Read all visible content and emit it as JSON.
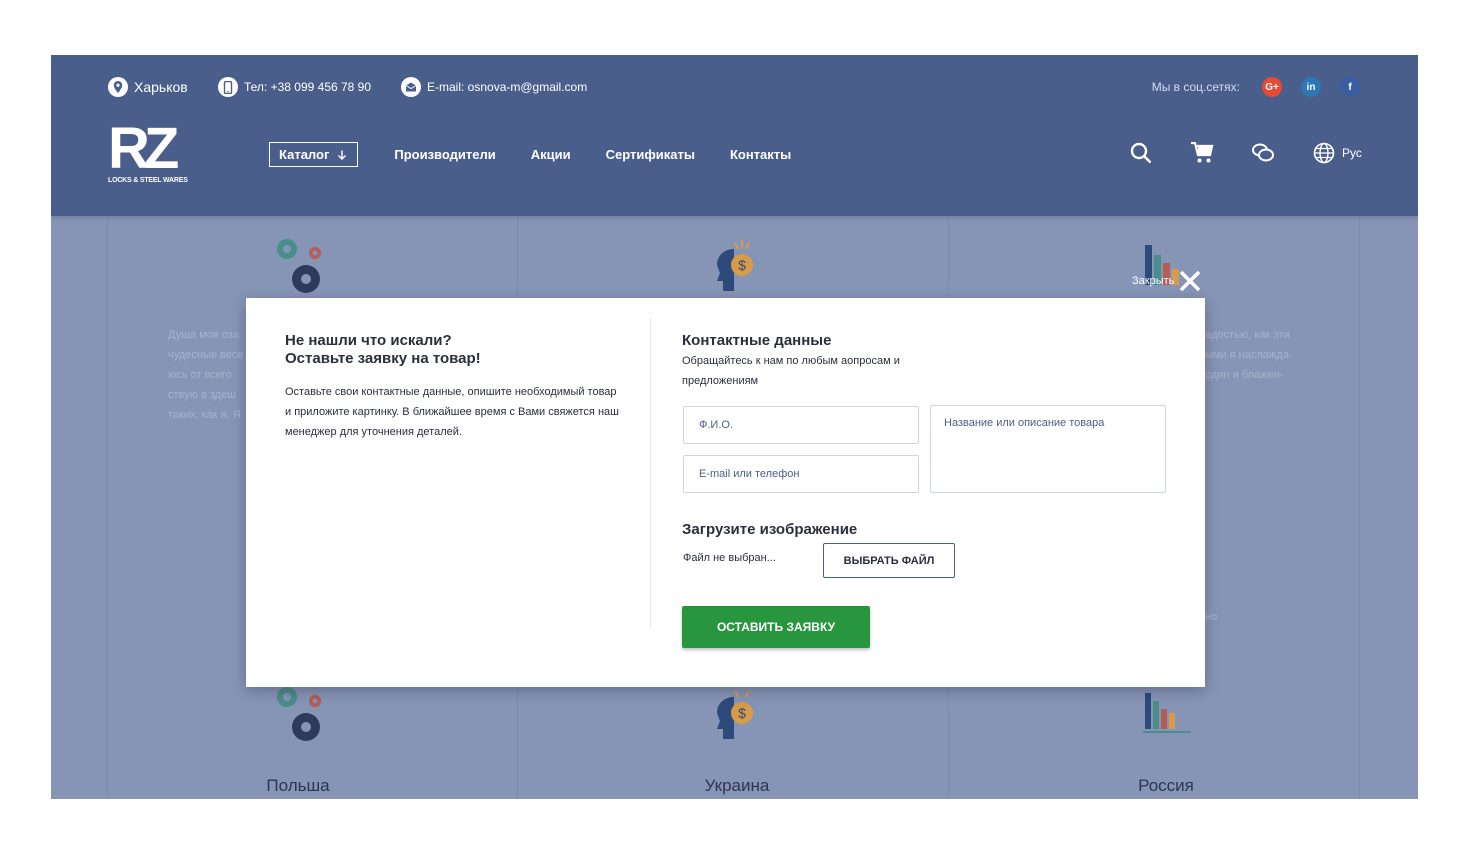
{
  "header": {
    "city": "Харьков",
    "phone": "Тел: +38 099 456 78 90",
    "email": "E-mail: osnova-m@gmail.com",
    "social_label": "Мы в соц.сетях:",
    "social": [
      {
        "name": "google-plus",
        "label": "G+"
      },
      {
        "name": "linkedin",
        "label": "in"
      },
      {
        "name": "facebook",
        "label": "f"
      }
    ],
    "logo_mark": "RZ",
    "logo_sub": "LOCKS & STEEL WARES",
    "nav": {
      "catalog": "Каталог",
      "items": [
        "Производители",
        "Акции",
        "Сертификаты",
        "Контакты"
      ]
    },
    "language": "Рус"
  },
  "background": {
    "countries": [
      "Польша",
      "Украина",
      "Россия"
    ],
    "left_text": [
      "Душа моя оза",
      "чудесные весе",
      "юсь от всего",
      "ствую в здеш",
      "таких, как я. Я"
    ],
    "right_text": [
      "адостью, как эти",
      "ыми я наслажда-",
      "один и блажен-"
    ],
    "right_fragment": "но"
  },
  "modal": {
    "close_label": "Закрыть",
    "left_title_line1": "Не нашли что искали?",
    "left_title_line2": "Оставьте заявку на товар!",
    "left_text": "Оставьте свои контактные данные, опишите необходимый товар и приложите картинку. В ближайшее время с Вами свяжется наш менеджер для уточнения деталей.",
    "contact_title": "Контактные данные",
    "contact_sub": "Обращайтесь к нам по любым аопросам и предложениям",
    "fio_placeholder": "Ф.И.О.",
    "contact_placeholder": "E-mail или телефон",
    "product_placeholder": "Название или описание товара",
    "upload_title": "Загрузите изображение",
    "no_file": "Файл не выбран...",
    "choose_file": "ВЫБРАТЬ ФАЙЛ",
    "submit": "ОСТАВИТЬ ЗАЯВКУ"
  },
  "colors": {
    "header": "#4a5e8c",
    "overlay": "#8694b6",
    "submit": "#28963e"
  }
}
